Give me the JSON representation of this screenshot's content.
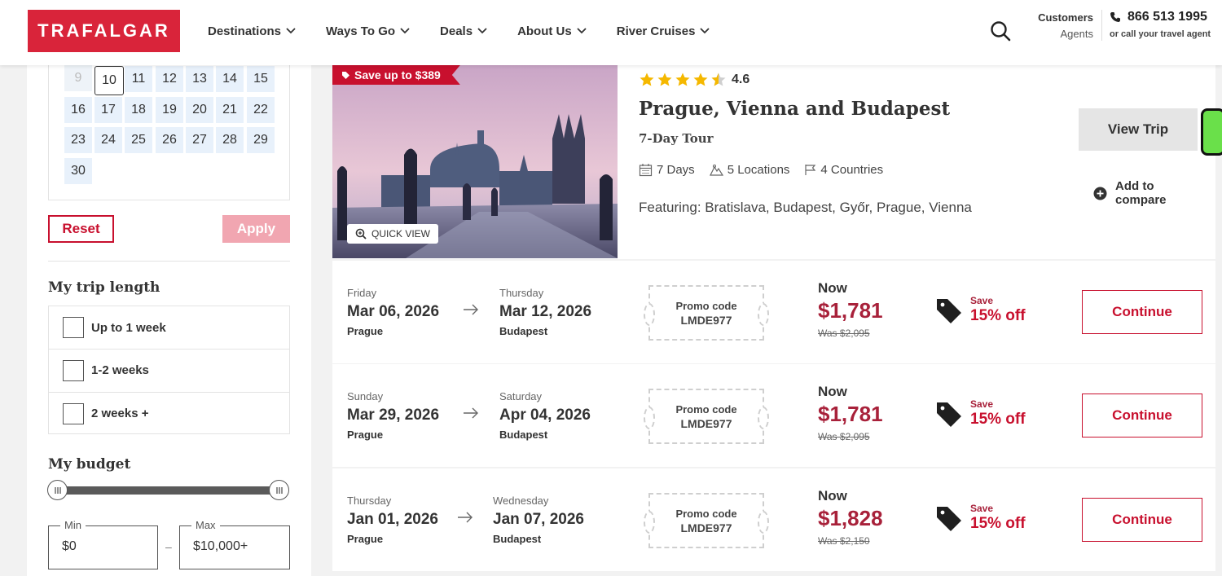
{
  "brand": {
    "logo_text": "TRAFALGAR",
    "accent": "#c8102e"
  },
  "nav": {
    "items": [
      {
        "label": "Destinations"
      },
      {
        "label": "Ways To Go"
      },
      {
        "label": "Deals"
      },
      {
        "label": "About Us"
      },
      {
        "label": "River Cruises"
      }
    ],
    "search_icon": "search-icon",
    "customers": "Customers",
    "agents": "Agents",
    "phone": "866 513 1995",
    "phone_sub": "or call your travel agent"
  },
  "calendar": {
    "days": [
      "9",
      "10",
      "11",
      "12",
      "13",
      "14",
      "15",
      "16",
      "17",
      "18",
      "19",
      "20",
      "21",
      "22",
      "23",
      "24",
      "25",
      "26",
      "27",
      "28",
      "29",
      "30"
    ],
    "disabled_day": "9",
    "selected_day": "10"
  },
  "filters": {
    "reset_label": "Reset",
    "apply_label": "Apply",
    "trip_length_title": "My trip length",
    "trip_lengths": [
      {
        "label": "Up to 1 week",
        "checked": false
      },
      {
        "label": "1-2 weeks",
        "checked": false
      },
      {
        "label": "2 weeks +",
        "checked": false
      }
    ],
    "budget_title": "My budget",
    "min_label": "Min",
    "min_value": "$0",
    "max_label": "Max",
    "max_value": "$10,000+",
    "range_separator": "–"
  },
  "tour": {
    "save_badge": "Save up to $389",
    "quick_view": "QUICK VIEW",
    "rating": "4.6",
    "rating_stars": 4.5,
    "title": "Prague, Vienna and Budapest",
    "subtitle": "7-Day Tour",
    "days": "7 Days",
    "locations": "5 Locations",
    "countries": "4 Countries",
    "featuring": "Featuring: Bratislava, Budapest, Győr, Prague, Vienna",
    "view_trip": "View Trip",
    "compare": "Add to compare"
  },
  "departures": [
    {
      "start_dow": "Friday",
      "start_date": "Mar 06, 2026",
      "start_city": "Prague",
      "end_dow": "Thursday",
      "end_date": "Mar 12, 2026",
      "end_city": "Budapest",
      "promo_label": "Promo code",
      "promo_code": "LMDE977",
      "now_label": "Now",
      "price": "$1,781",
      "was": "Was $2,095",
      "save_label": "Save",
      "save_pct": "15% off",
      "cta": "Continue"
    },
    {
      "start_dow": "Sunday",
      "start_date": "Mar 29, 2026",
      "start_city": "Prague",
      "end_dow": "Saturday",
      "end_date": "Apr 04, 2026",
      "end_city": "Budapest",
      "promo_label": "Promo code",
      "promo_code": "LMDE977",
      "now_label": "Now",
      "price": "$1,781",
      "was": "Was $2,095",
      "save_label": "Save",
      "save_pct": "15% off",
      "cta": "Continue"
    },
    {
      "start_dow": "Thursday",
      "start_date": "Jan 01, 2026",
      "start_city": "Prague",
      "end_dow": "Wednesday",
      "end_date": "Jan 07, 2026",
      "end_city": "Budapest",
      "promo_label": "Promo code",
      "promo_code": "LMDE977",
      "now_label": "Now",
      "price": "$1,828",
      "was": "Was $2,150",
      "save_label": "Save",
      "save_pct": "15% off",
      "cta": "Continue"
    }
  ]
}
